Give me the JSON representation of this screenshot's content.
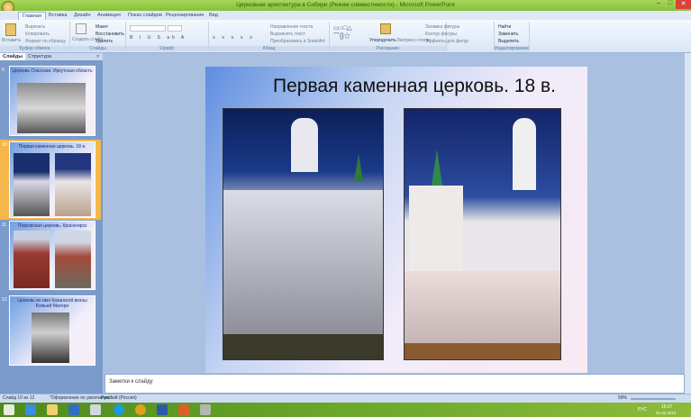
{
  "window": {
    "title": "Церковная архитектура в Сибири (Режим совместимости) - Microsoft PowerPoint",
    "minimize": "–",
    "maximize": "□",
    "close": "✕"
  },
  "tabs": [
    "Главная",
    "Вставка",
    "Дизайн",
    "Анимация",
    "Показ слайдов",
    "Рецензирование",
    "Вид"
  ],
  "ribbon": {
    "clipboard": {
      "label": "Буфер обмена",
      "paste": "Вставить",
      "cut": "Вырезать",
      "copy": "Копировать",
      "format": "Формат по образцу"
    },
    "slides": {
      "label": "Слайды",
      "new": "Создать слайд",
      "layout": "Макет",
      "reset": "Восстановить",
      "delete": "Удалить"
    },
    "font": {
      "label": "Шрифт"
    },
    "paragraph": {
      "label": "Абзац",
      "direction": "Направление текста",
      "align": "Выровнять текст",
      "smartart": "Преобразовать в SmartArt"
    },
    "drawing": {
      "label": "Рисование",
      "arrange": "Упорядочить",
      "styles": "Экспресс-стили",
      "fill": "Заливка фигуры",
      "outline": "Контур фигуры",
      "effects": "Эффекты для фигур"
    },
    "editing": {
      "label": "Редактирование",
      "find": "Найти",
      "replace": "Заменить",
      "select": "Выделить"
    }
  },
  "panel": {
    "tabs": [
      "Слайды",
      "Структура"
    ],
    "close": "×"
  },
  "thumbnails": [
    {
      "num": "9",
      "title": "Церковь Спасская. Иркутская область"
    },
    {
      "num": "10",
      "title": "Первая каменная церковь. 18 в."
    },
    {
      "num": "11",
      "title": "Покровская церковь. Красноярск"
    },
    {
      "num": "12",
      "title": "Церковь во имя Казанской иконы Божьей Матери"
    }
  ],
  "slide": {
    "title": "Первая каменная церковь. 18 в."
  },
  "notes": {
    "placeholder": "Заметки к слайду"
  },
  "status": {
    "slide": "Слайд 10 из 12",
    "theme": "\"Оформление по умолчанию\"",
    "lang": "Русский (Россия)",
    "zoom": "59%"
  },
  "taskbar": {
    "lang": "РУС",
    "time": "16:27",
    "date": "01.02.2016"
  }
}
